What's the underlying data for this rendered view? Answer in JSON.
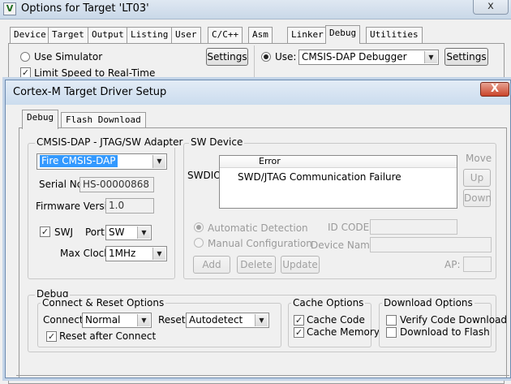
{
  "outer": {
    "app_icon": "V",
    "title": "Options for Target 'LT03'",
    "close_label": "x",
    "tabs": [
      "Device",
      "Target",
      "Output",
      "Listing",
      "User",
      "C/C++",
      "Asm",
      "Linker",
      "Debug",
      "Utilities"
    ],
    "use_simulator_label": "Use Simulator",
    "limit_speed_label": "Limit Speed to Real-Time",
    "settings_label": "Settings",
    "use_label": "Use:",
    "debugger_value": "CMSIS-DAP Debugger",
    "settings2_label": "Settings"
  },
  "inner": {
    "title": "Cortex-M Target Driver Setup",
    "close_label": "X",
    "tabs": [
      "Debug",
      "Flash Download"
    ],
    "adapter": {
      "group_label": "CMSIS-DAP - JTAG/SW Adapter",
      "adapter_value": "Fire CMSIS-DAP",
      "serial_label": "Serial No:",
      "serial_value": "HS-00000868",
      "firmware_label": "Firmware Version:",
      "firmware_value": "1.0",
      "swj_label": "SWJ",
      "port_label": "Port:",
      "port_value": "SW",
      "maxclock_label": "Max Clock:",
      "maxclock_value": "1MHz"
    },
    "sw_device": {
      "group_label": "SW Device",
      "swdio_label": "SWDIO",
      "column_error": "Error",
      "error_text": "SWD/JTAG Communication Failure",
      "move_label": "Move",
      "up_label": "Up",
      "down_label": "Down",
      "auto_detect_label": "Automatic Detection",
      "manual_config_label": "Manual Configuration",
      "idcode_label": "ID CODE:",
      "devname_label": "Device Name:",
      "add_label": "Add",
      "delete_label": "Delete",
      "update_label": "Update",
      "ap_label": "AP:"
    },
    "debug_group": {
      "group_label": "Debug",
      "connect_reset_label": "Connect & Reset Options",
      "connect_label": "Connect:",
      "connect_value": "Normal",
      "reset_label": "Reset:",
      "reset_value": "Autodetect",
      "reset_after_connect_label": "Reset after Connect",
      "cache_options_label": "Cache Options",
      "cache_code_label": "Cache Code",
      "cache_memory_label": "Cache Memory",
      "download_options_label": "Download Options",
      "verify_download_label": "Verify Code Download",
      "download_flash_label": "Download to Flash"
    }
  },
  "checkbox_mark": "✓",
  "dropdown_icon": "▼",
  "colors": {
    "selection_blue": "#3399ff",
    "dialog_bg": "#f0f0f0",
    "close_red": "#c9442a"
  }
}
